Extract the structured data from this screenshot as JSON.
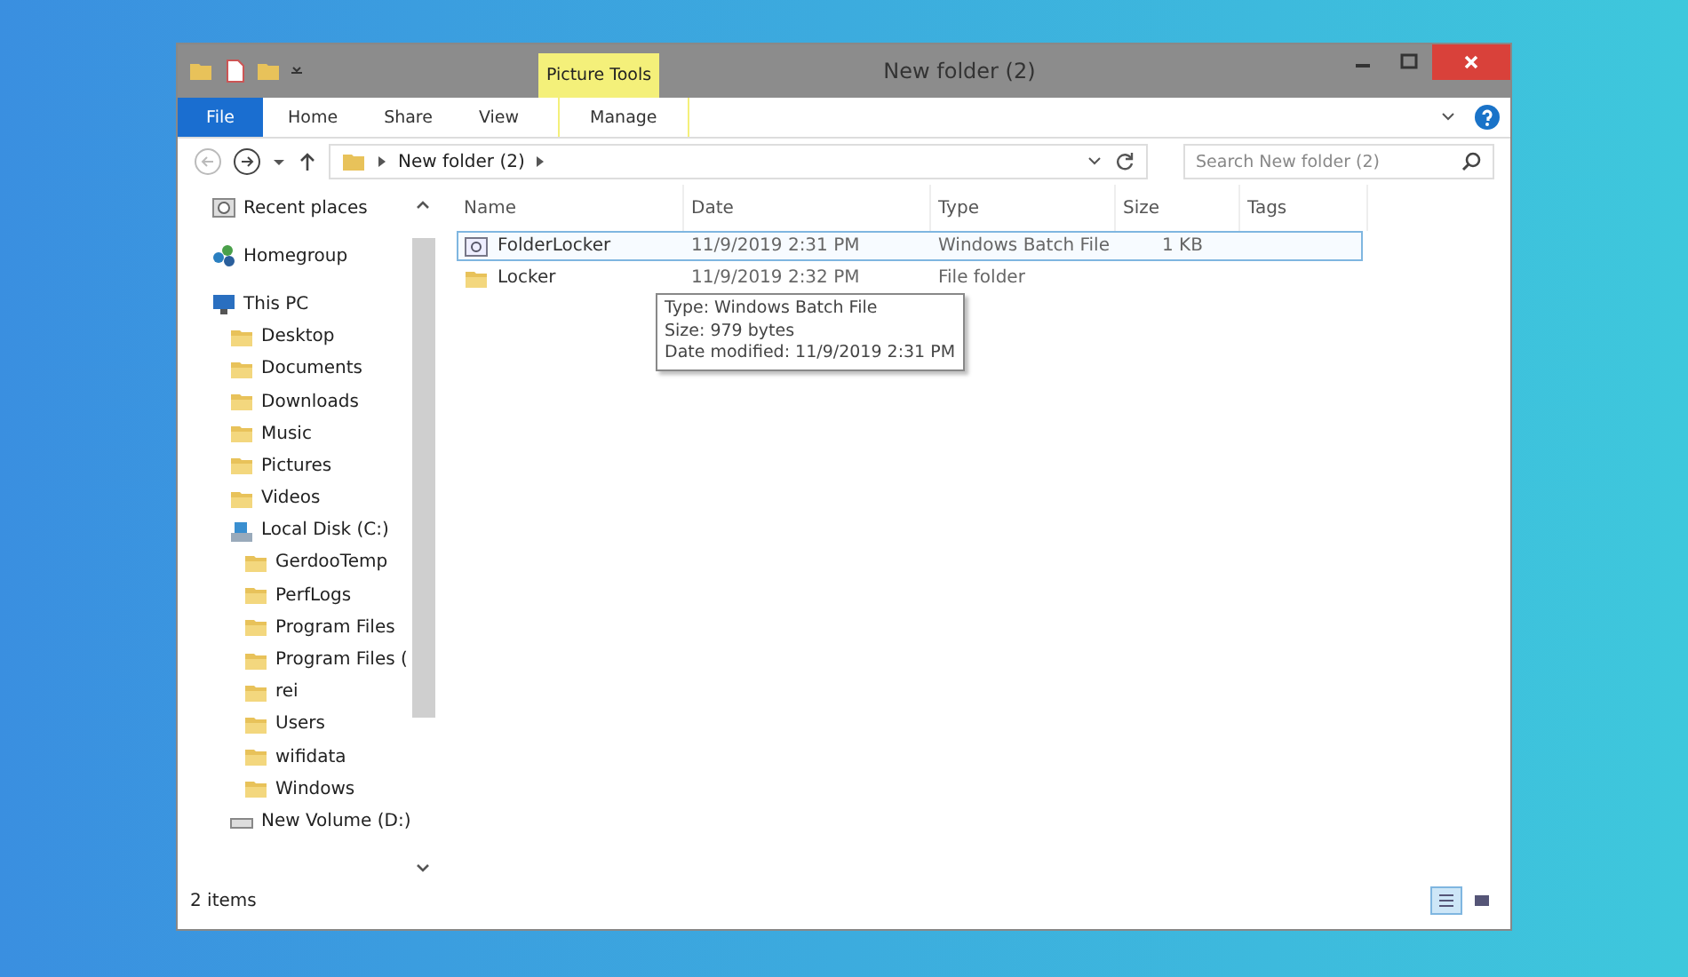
{
  "window": {
    "title": "New folder (2)"
  },
  "ribbon": {
    "file_button": "File",
    "tabs": [
      "Home",
      "Share",
      "View"
    ],
    "contextual": {
      "group": "Picture Tools",
      "tab": "Manage"
    }
  },
  "address_bar": {
    "path": "New folder (2)",
    "search_placeholder": "Search New folder (2)"
  },
  "sidebar": {
    "items": [
      {
        "label": "Recent places",
        "kind": "recent"
      },
      {
        "label": "Homegroup",
        "kind": "homegroup"
      },
      {
        "label": "This PC",
        "kind": "pc",
        "children": [
          {
            "label": "Desktop",
            "kind": "folder"
          },
          {
            "label": "Documents",
            "kind": "folder"
          },
          {
            "label": "Downloads",
            "kind": "folder"
          },
          {
            "label": "Music",
            "kind": "folder"
          },
          {
            "label": "Pictures",
            "kind": "folder"
          },
          {
            "label": "Videos",
            "kind": "folder"
          },
          {
            "label": "Local Disk (C:)",
            "kind": "drive",
            "children": [
              {
                "label": "GerdooTemp",
                "kind": "folder"
              },
              {
                "label": "PerfLogs",
                "kind": "folder"
              },
              {
                "label": "Program Files",
                "kind": "folder"
              },
              {
                "label": "Program Files (",
                "kind": "folder"
              },
              {
                "label": "rei",
                "kind": "folder"
              },
              {
                "label": "Users",
                "kind": "folder"
              },
              {
                "label": "wifidata",
                "kind": "folder"
              },
              {
                "label": "Windows",
                "kind": "folder"
              }
            ]
          },
          {
            "label": "New Volume (D:)",
            "kind": "disk"
          }
        ]
      }
    ]
  },
  "table": {
    "columns": [
      "Name",
      "Date",
      "Type",
      "Size",
      "Tags"
    ],
    "rows": [
      {
        "name": "FolderLocker",
        "date": "11/9/2019 2:31 PM",
        "type": "Windows Batch File",
        "size": "1 KB",
        "kind": "batch",
        "selected": true
      },
      {
        "name": "Locker",
        "date": "11/9/2019 2:32 PM",
        "type": "File folder",
        "size": "",
        "kind": "folder",
        "selected": false
      }
    ]
  },
  "tooltip": [
    "Type: Windows Batch File",
    "Size: 979 bytes",
    "Date modified: 11/9/2019 2:31 PM"
  ],
  "status_bar": {
    "count": "2 items",
    "views": [
      {
        "kind": "details",
        "selected": true
      },
      {
        "kind": "large",
        "selected": false
      }
    ]
  }
}
